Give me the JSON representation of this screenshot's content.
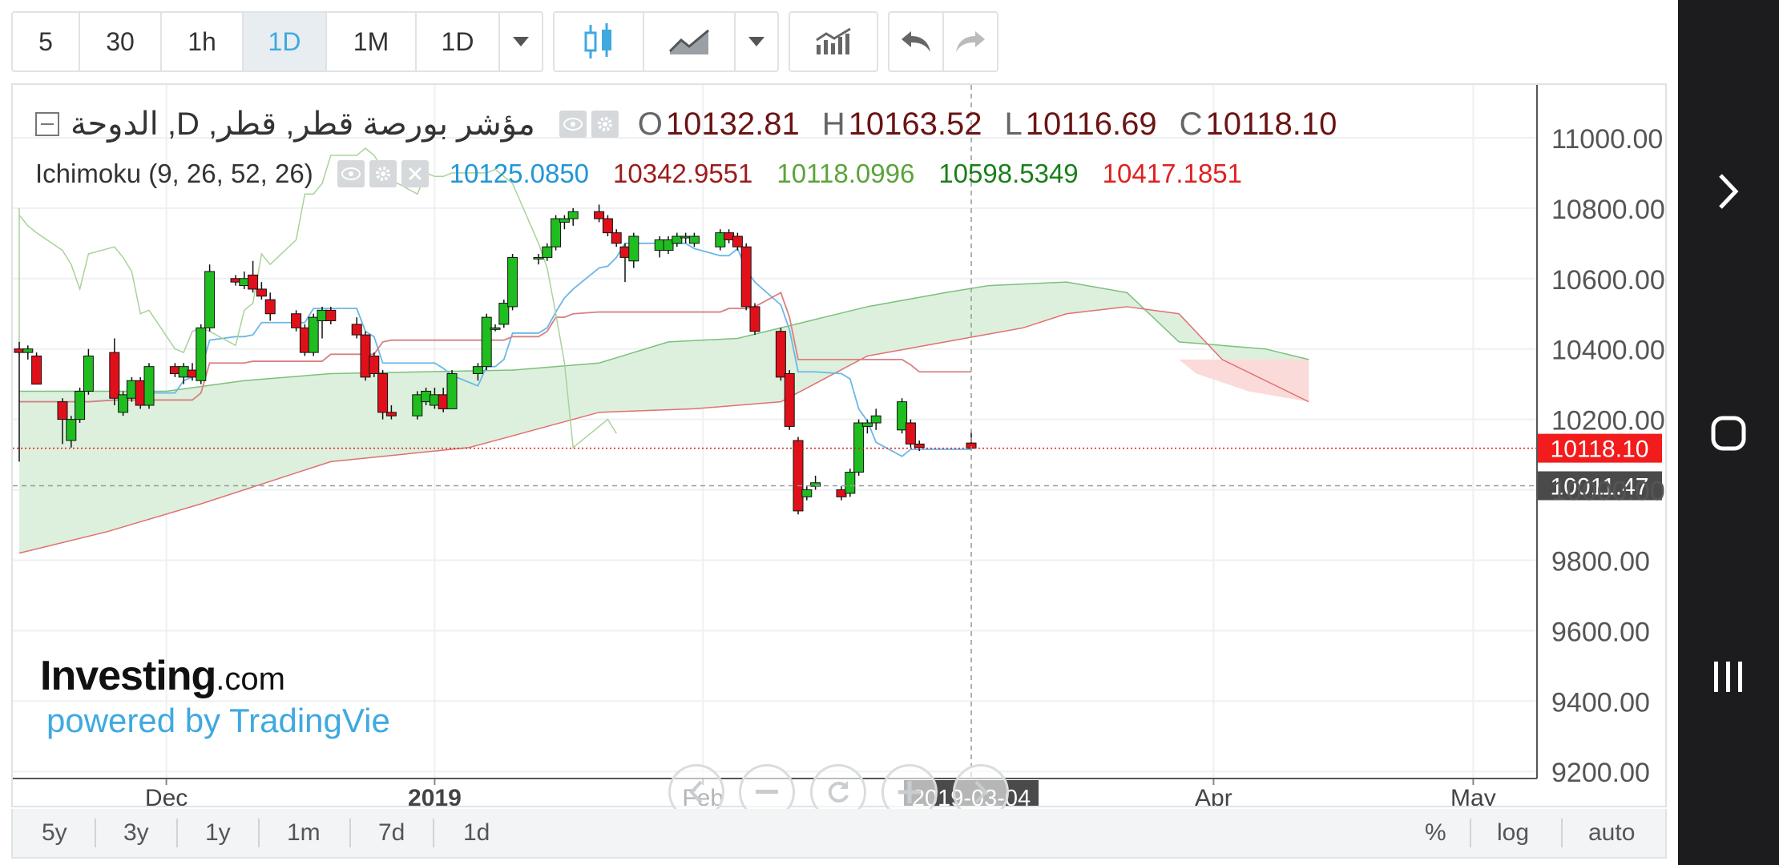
{
  "toolbar": {
    "intervals": [
      "5",
      "30",
      "1h",
      "1D",
      "1M",
      "1D"
    ],
    "active_interval": "1D"
  },
  "legend": {
    "symbol": "مؤشر بورصة قطر, قطر, D, الدوحة",
    "open_label": "O",
    "open": "10132.81",
    "high_label": "H",
    "high": "10163.52",
    "low_label": "L",
    "low": "10116.69",
    "close_label": "C",
    "close": "10118.10",
    "indicator": "Ichimoku (9, 26, 52, 26)",
    "indicator_values": [
      {
        "value": "10125.0850",
        "color": "#2196d6"
      },
      {
        "value": "10342.9551",
        "color": "#9b1c1c"
      },
      {
        "value": "10118.0996",
        "color": "#5ba33a"
      },
      {
        "value": "10598.5349",
        "color": "#1a7f1a"
      },
      {
        "value": "10417.1851",
        "color": "#e02020"
      }
    ]
  },
  "price_labels": {
    "last_price": "10118.10",
    "crosshair_price": "10011.47",
    "crosshair_date": "2019-03-04"
  },
  "branding": {
    "logo_main": "Investing",
    "logo_suffix": ".com",
    "powered_by": "powered by TradingVie"
  },
  "bottom_bar": {
    "ranges": [
      "5y",
      "3y",
      "1y",
      "1m",
      "7d",
      "1d"
    ],
    "options": [
      "%",
      "log",
      "auto"
    ]
  },
  "colors": {
    "up": "#1fbd1f",
    "down": "#e0101a",
    "accent": "#3fa9e0",
    "cloud_bull": "#d9eed9",
    "cloud_bear": "#fbdada"
  },
  "chart_data": {
    "type": "candlestick",
    "title": "مؤشر بورصة قطر, قطر, D, الدوحة",
    "y_axis_ticks": [
      "11000.00",
      "10800.00",
      "10600.00",
      "10400.00",
      "10200.00",
      "10000.00",
      "9800.00",
      "9600.00",
      "9400.00",
      "9200.00"
    ],
    "ylim": [
      9180,
      11150
    ],
    "x_axis_ticks": [
      "Dec",
      "2019",
      "Feb",
      "Apr",
      "May"
    ],
    "candles": [
      {
        "date": "2018-11-14",
        "o": 10400,
        "h": 10420,
        "l": 10080,
        "c": 10390
      },
      {
        "date": "2018-11-15",
        "o": 10390,
        "h": 10410,
        "l": 10370,
        "c": 10400
      },
      {
        "date": "2018-11-16",
        "o": 10380,
        "h": 10390,
        "l": 10300,
        "c": 10300
      },
      {
        "date": "2018-11-19",
        "o": 10250,
        "h": 10260,
        "l": 10130,
        "c": 10200
      },
      {
        "date": "2018-11-20",
        "o": 10140,
        "h": 10210,
        "l": 10120,
        "c": 10200
      },
      {
        "date": "2018-11-21",
        "o": 10200,
        "h": 10290,
        "l": 10190,
        "c": 10280
      },
      {
        "date": "2018-11-22",
        "o": 10280,
        "h": 10400,
        "l": 10270,
        "c": 10380
      },
      {
        "date": "2018-11-25",
        "o": 10390,
        "h": 10430,
        "l": 10240,
        "c": 10260
      },
      {
        "date": "2018-11-26",
        "o": 10220,
        "h": 10280,
        "l": 10210,
        "c": 10270
      },
      {
        "date": "2018-11-27",
        "o": 10260,
        "h": 10320,
        "l": 10250,
        "c": 10310
      },
      {
        "date": "2018-11-28",
        "o": 10310,
        "h": 10320,
        "l": 10230,
        "c": 10240
      },
      {
        "date": "2018-11-29",
        "o": 10240,
        "h": 10360,
        "l": 10230,
        "c": 10350
      },
      {
        "date": "2018-12-02",
        "o": 10350,
        "h": 10360,
        "l": 10320,
        "c": 10330
      },
      {
        "date": "2018-12-03",
        "o": 10320,
        "h": 10360,
        "l": 10300,
        "c": 10350
      },
      {
        "date": "2018-12-04",
        "o": 10340,
        "h": 10360,
        "l": 10310,
        "c": 10320
      },
      {
        "date": "2018-12-05",
        "o": 10310,
        "h": 10470,
        "l": 10300,
        "c": 10460
      },
      {
        "date": "2018-12-06",
        "o": 10460,
        "h": 10640,
        "l": 10450,
        "c": 10620
      },
      {
        "date": "2018-12-09",
        "o": 10600,
        "h": 10610,
        "l": 10580,
        "c": 10590
      },
      {
        "date": "2018-12-10",
        "o": 10580,
        "h": 10620,
        "l": 10570,
        "c": 10600
      },
      {
        "date": "2018-12-11",
        "o": 10610,
        "h": 10650,
        "l": 10560,
        "c": 10570
      },
      {
        "date": "2018-12-12",
        "o": 10570,
        "h": 10590,
        "l": 10540,
        "c": 10550
      },
      {
        "date": "2018-12-13",
        "o": 10540,
        "h": 10560,
        "l": 10480,
        "c": 10500
      },
      {
        "date": "2018-12-16",
        "o": 10500,
        "h": 10510,
        "l": 10450,
        "c": 10460
      },
      {
        "date": "2018-12-17",
        "o": 10460,
        "h": 10470,
        "l": 10380,
        "c": 10390
      },
      {
        "date": "2018-12-18",
        "o": 10390,
        "h": 10500,
        "l": 10380,
        "c": 10490
      },
      {
        "date": "2018-12-19",
        "o": 10480,
        "h": 10520,
        "l": 10430,
        "c": 10510
      },
      {
        "date": "2018-12-20",
        "o": 10510,
        "h": 10520,
        "l": 10470,
        "c": 10480
      },
      {
        "date": "2018-12-23",
        "o": 10470,
        "h": 10490,
        "l": 10430,
        "c": 10440
      },
      {
        "date": "2018-12-24",
        "o": 10440,
        "h": 10450,
        "l": 10310,
        "c": 10320
      },
      {
        "date": "2018-12-25",
        "o": 10380,
        "h": 10390,
        "l": 10320,
        "c": 10330
      },
      {
        "date": "2018-12-26",
        "o": 10330,
        "h": 10340,
        "l": 10200,
        "c": 10220
      },
      {
        "date": "2018-12-27",
        "o": 10220,
        "h": 10240,
        "l": 10200,
        "c": 10210
      },
      {
        "date": "2018-12-30",
        "o": 10210,
        "h": 10280,
        "l": 10200,
        "c": 10270
      },
      {
        "date": "2018-12-31",
        "o": 10250,
        "h": 10290,
        "l": 10240,
        "c": 10280
      },
      {
        "date": "2019-01-01",
        "o": 10240,
        "h": 10290,
        "l": 10230,
        "c": 10270
      },
      {
        "date": "2019-01-02",
        "o": 10270,
        "h": 10290,
        "l": 10220,
        "c": 10230
      },
      {
        "date": "2019-01-03",
        "o": 10230,
        "h": 10340,
        "l": 10230,
        "c": 10330
      },
      {
        "date": "2019-01-06",
        "o": 10330,
        "h": 10360,
        "l": 10310,
        "c": 10350
      },
      {
        "date": "2019-01-07",
        "o": 10350,
        "h": 10500,
        "l": 10340,
        "c": 10490
      },
      {
        "date": "2019-01-08",
        "o": 10460,
        "h": 10470,
        "l": 10450,
        "c": 10460
      },
      {
        "date": "2019-01-09",
        "o": 10470,
        "h": 10540,
        "l": 10460,
        "c": 10530
      },
      {
        "date": "2019-01-10",
        "o": 10520,
        "h": 10670,
        "l": 10510,
        "c": 10660
      },
      {
        "date": "2019-01-13",
        "o": 10660,
        "h": 10670,
        "l": 10640,
        "c": 10660
      },
      {
        "date": "2019-01-14",
        "o": 10660,
        "h": 10700,
        "l": 10650,
        "c": 10690
      },
      {
        "date": "2019-01-15",
        "o": 10690,
        "h": 10780,
        "l": 10680,
        "c": 10770
      },
      {
        "date": "2019-01-16",
        "o": 10760,
        "h": 10780,
        "l": 10740,
        "c": 10770
      },
      {
        "date": "2019-01-17",
        "o": 10770,
        "h": 10800,
        "l": 10750,
        "c": 10790
      },
      {
        "date": "2019-01-20",
        "o": 10790,
        "h": 10810,
        "l": 10760,
        "c": 10770
      },
      {
        "date": "2019-01-21",
        "o": 10770,
        "h": 10780,
        "l": 10720,
        "c": 10730
      },
      {
        "date": "2019-01-22",
        "o": 10730,
        "h": 10740,
        "l": 10690,
        "c": 10700
      },
      {
        "date": "2019-01-23",
        "o": 10690,
        "h": 10700,
        "l": 10590,
        "c": 10660
      },
      {
        "date": "2019-01-24",
        "o": 10650,
        "h": 10730,
        "l": 10630,
        "c": 10720
      },
      {
        "date": "2019-01-27",
        "o": 10680,
        "h": 10720,
        "l": 10660,
        "c": 10710
      },
      {
        "date": "2019-01-28",
        "o": 10680,
        "h": 10720,
        "l": 10670,
        "c": 10710
      },
      {
        "date": "2019-01-29",
        "o": 10700,
        "h": 10730,
        "l": 10690,
        "c": 10720
      },
      {
        "date": "2019-01-30",
        "o": 10720,
        "h": 10730,
        "l": 10700,
        "c": 10720
      },
      {
        "date": "2019-01-31",
        "o": 10700,
        "h": 10730,
        "l": 10690,
        "c": 10720
      },
      {
        "date": "2019-02-03",
        "o": 10690,
        "h": 10740,
        "l": 10680,
        "c": 10730
      },
      {
        "date": "2019-02-04",
        "o": 10730,
        "h": 10740,
        "l": 10700,
        "c": 10710
      },
      {
        "date": "2019-02-05",
        "o": 10720,
        "h": 10730,
        "l": 10680,
        "c": 10690
      },
      {
        "date": "2019-02-06",
        "o": 10690,
        "h": 10700,
        "l": 10510,
        "c": 10520
      },
      {
        "date": "2019-02-07",
        "o": 10520,
        "h": 10530,
        "l": 10440,
        "c": 10450
      },
      {
        "date": "2019-02-10",
        "o": 10450,
        "h": 10460,
        "l": 10310,
        "c": 10320
      },
      {
        "date": "2019-02-11",
        "o": 10330,
        "h": 10340,
        "l": 10170,
        "c": 10180
      },
      {
        "date": "2019-02-12",
        "o": 10140,
        "h": 10150,
        "l": 9930,
        "c": 9940
      },
      {
        "date": "2019-02-13",
        "o": 9980,
        "h": 10010,
        "l": 9970,
        "c": 10000
      },
      {
        "date": "2019-02-14",
        "o": 10010,
        "h": 10040,
        "l": 10000,
        "c": 10020
      },
      {
        "date": "2019-02-17",
        "o": 10000,
        "h": 10010,
        "l": 9970,
        "c": 9980
      },
      {
        "date": "2019-02-18",
        "o": 9990,
        "h": 10060,
        "l": 9980,
        "c": 10050
      },
      {
        "date": "2019-02-19",
        "o": 10050,
        "h": 10200,
        "l": 10040,
        "c": 10190
      },
      {
        "date": "2019-02-20",
        "o": 10180,
        "h": 10200,
        "l": 10160,
        "c": 10190
      },
      {
        "date": "2019-02-21",
        "o": 10190,
        "h": 10230,
        "l": 10170,
        "c": 10210
      },
      {
        "date": "2019-02-24",
        "o": 10170,
        "h": 10260,
        "l": 10160,
        "c": 10250
      },
      {
        "date": "2019-02-25",
        "o": 10190,
        "h": 10200,
        "l": 10120,
        "c": 10130
      },
      {
        "date": "2019-02-26",
        "o": 10130,
        "h": 10140,
        "l": 10110,
        "c": 10120
      },
      {
        "date": "2019-03-04",
        "o": 10132.81,
        "h": 10163.52,
        "l": 10116.69,
        "c": 10118.1
      }
    ]
  }
}
